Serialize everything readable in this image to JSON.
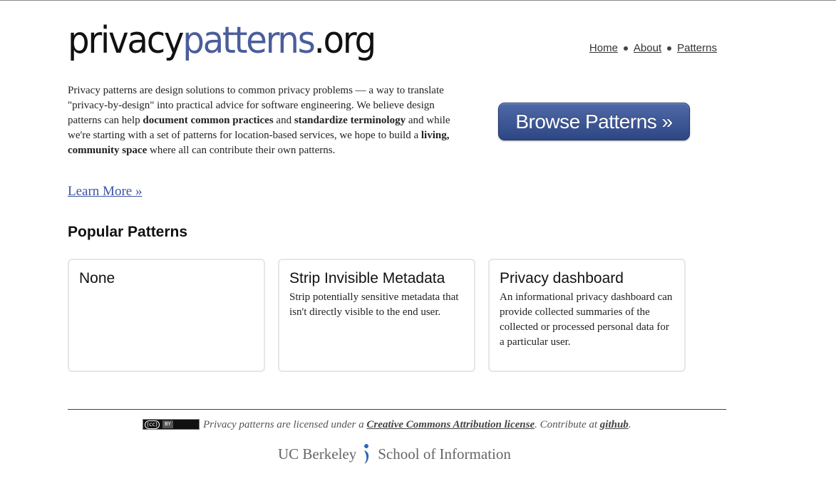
{
  "site": {
    "logo_part1": "privacy",
    "logo_part2": "patterns",
    "logo_part3": ".org"
  },
  "nav": {
    "items": [
      {
        "label": "Home"
      },
      {
        "label": "About"
      },
      {
        "label": "Patterns"
      }
    ]
  },
  "intro": {
    "t1": "Privacy patterns are design solutions to common privacy problems — a way to translate \"privacy-by-design\" into practical advice for software engineering. We believe design patterns can help ",
    "b1": "document common practices",
    "t2": " and ",
    "b2": "standardize terminology",
    "t3": " and while we're starting with a set of patterns for location-based services, we hope to build a ",
    "b3": "living, community space",
    "t4": " where all can contribute their own patterns."
  },
  "learn_more_label": "Learn More »",
  "browse_button_label": "Browse Patterns »",
  "popular": {
    "title": "Popular Patterns",
    "cards": [
      {
        "title": "None",
        "description": ""
      },
      {
        "title": "Strip Invisible Metadata",
        "description": "Strip potentially sensitive metadata that isn't directly visible to the end user."
      },
      {
        "title": "Privacy dashboard",
        "description": "An informational privacy dashboard can provide collected summaries of the collected or processed personal data for a particular user."
      }
    ]
  },
  "footer": {
    "cc_badge": "(cc)",
    "by_badge": "BY",
    "license_prefix": "Privacy patterns are licensed under a ",
    "license_link": "Creative Commons Attribution license",
    "contribute_text": ". Contribute at ",
    "github_link": "github",
    "end": ".",
    "ucb_left": "UC Berkeley",
    "ucb_right": "School of Information"
  },
  "colors": {
    "accent": "#4a5d9c",
    "button": "#3a5291",
    "link": "#3e54a3",
    "berkeley_blue": "#2a6ab8"
  }
}
